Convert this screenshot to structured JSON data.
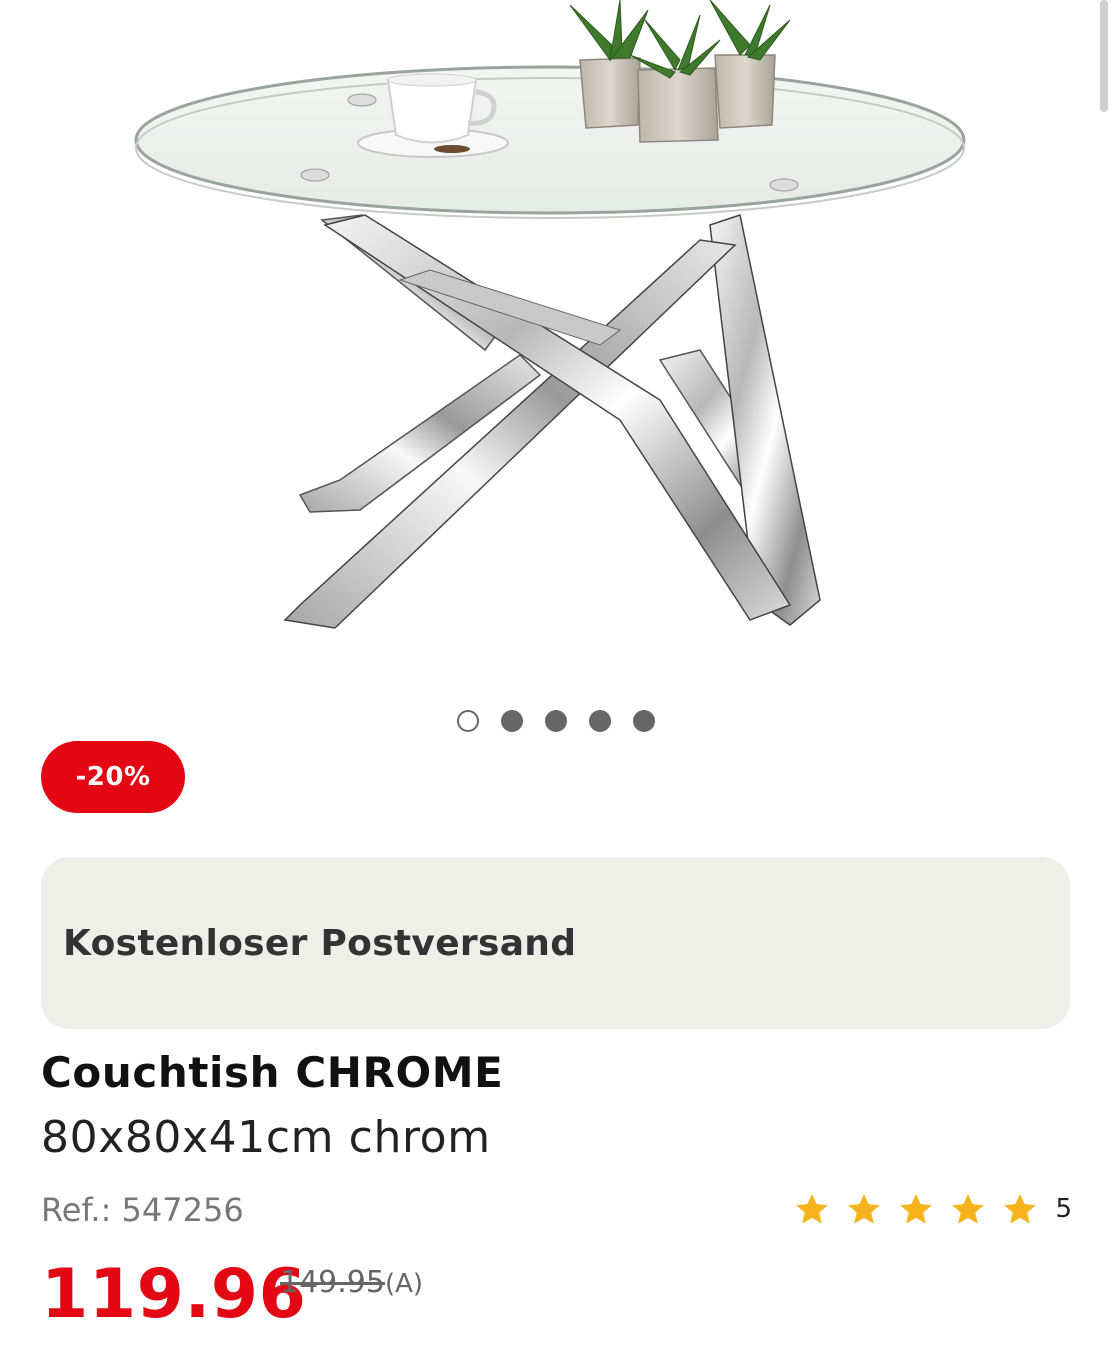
{
  "gallery": {
    "image_alt": "Couchtish CHROME glass coffee table with chrome legs",
    "dots_total": 5,
    "dots_active_index": 0
  },
  "badge": {
    "discount_label": "-20%"
  },
  "shipping": {
    "label": "Kostenloser Postversand"
  },
  "product": {
    "title": "Couchtish CHROME",
    "subtitle": "80x80x41cm chrom",
    "ref": "Ref.: 547256",
    "rating_value": 5,
    "rating_count": "5",
    "price": "119.96",
    "old_price": "149.95",
    "old_price_suffix": "(A)"
  },
  "colors": {
    "accent_red": "#e30613",
    "star_color": "#f5b31c",
    "shipping_bg": "#efefea"
  },
  "icons": {
    "star": "star-icon"
  }
}
